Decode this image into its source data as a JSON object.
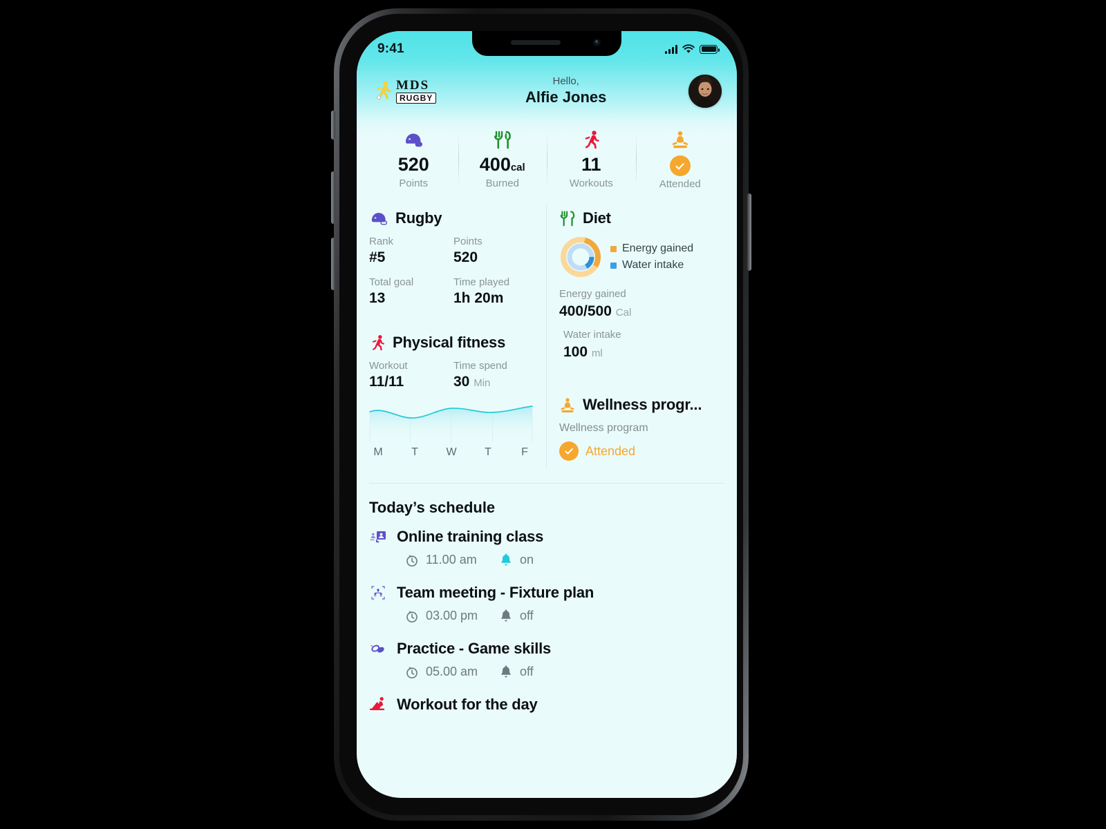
{
  "status_bar": {
    "time": "9:41",
    "signal_icon": "signal-bars-icon",
    "wifi_icon": "wifi-icon",
    "battery_icon": "battery-icon"
  },
  "header": {
    "logo_primary": "MDS",
    "logo_secondary": "RUGBY",
    "greeting": "Hello,",
    "user_name": "Alfie Jones",
    "avatar_icon": "user-avatar"
  },
  "stats": [
    {
      "icon": "rugby-helmet-icon",
      "value": "520",
      "unit": "",
      "label": "Points"
    },
    {
      "icon": "cutlery-icon",
      "value": "400",
      "unit": "cal",
      "label": "Burned"
    },
    {
      "icon": "running-icon",
      "value": "11",
      "unit": "",
      "label": "Workouts"
    },
    {
      "icon": "meditation-icon",
      "value": "",
      "unit": "",
      "label": "Attended",
      "badge": "check-circle-icon"
    }
  ],
  "rugby": {
    "icon": "rugby-helmet-icon",
    "title": "Rugby",
    "rank_label": "Rank",
    "rank_value": "#5",
    "points_label": "Points",
    "points_value": "520",
    "goal_label": "Total goal",
    "goal_value": "13",
    "time_label": "Time played",
    "time_value": "1h 20m"
  },
  "diet": {
    "icon": "cutlery-icon",
    "title": "Diet",
    "legend": [
      {
        "label": "Energy gained",
        "color": "#EFA93C"
      },
      {
        "label": "Water intake",
        "color": "#3D9FE0"
      }
    ],
    "energy_label": "Energy gained",
    "energy_value": "400/500",
    "energy_unit": "Cal",
    "water_label": "Water intake",
    "water_value": "100",
    "water_unit": "ml"
  },
  "fitness": {
    "icon": "running-icon",
    "title": "Physical fitness",
    "workout_label": "Workout",
    "workout_value": "11/11",
    "time_label": "Time spend",
    "time_value": "30",
    "time_unit": "Min"
  },
  "wellness": {
    "icon": "meditation-icon",
    "title": "Wellness progr...",
    "sub_label": "Wellness program",
    "status": "Attended",
    "status_icon": "check-circle-icon",
    "status_color": "#F6A72E"
  },
  "schedule": {
    "title": "Today’s schedule",
    "items": [
      {
        "icon": "online-class-icon",
        "name": "Online training class",
        "clock_icon": "stopwatch-icon",
        "time": "11.00 am",
        "bell_icon": "bell-icon",
        "alarm": "on",
        "alarm_on": true
      },
      {
        "icon": "team-meeting-icon",
        "name": "Team meeting - Fixture plan",
        "clock_icon": "stopwatch-icon",
        "time": "03.00 pm",
        "bell_icon": "bell-icon",
        "alarm": "off",
        "alarm_on": false
      },
      {
        "icon": "practice-icon",
        "name": "Practice - Game skills",
        "clock_icon": "stopwatch-icon",
        "time": "05.00 am",
        "bell_icon": "bell-icon",
        "alarm": "off",
        "alarm_on": false
      },
      {
        "icon": "workout-icon",
        "name": "Workout for the day",
        "clock_icon": "",
        "time": "",
        "bell_icon": "",
        "alarm": "",
        "alarm_on": false
      }
    ]
  },
  "chart_data": [
    {
      "type": "area",
      "title": "Physical fitness weekly activity",
      "categories": [
        "M",
        "T",
        "W",
        "T",
        "F"
      ],
      "values": [
        72,
        48,
        78,
        74,
        92
      ],
      "ylim": [
        0,
        100
      ],
      "xlabel": "",
      "ylabel": "",
      "grid": true,
      "legend": "none",
      "line_color": "#22C9D8",
      "fill_color": "#BFEFF5"
    },
    {
      "type": "pie",
      "title": "Diet progress",
      "labels": [
        "Energy gained",
        "Water intake"
      ],
      "series": [
        {
          "name": "Energy gained",
          "value": 400,
          "max": 500,
          "percent": 80,
          "color": "#EFA93C",
          "track_color": "#FBD79A"
        },
        {
          "name": "Water intake",
          "value": 100,
          "max": 500,
          "percent": 20,
          "color": "#3D9FE0",
          "track_color": "#BFDDF5"
        }
      ],
      "legend": "right"
    }
  ],
  "theme": {
    "screen_bg": "#EAFBFB",
    "header_gradient_start": "#4FE3E8",
    "header_gradient_end": "#EAFBFB",
    "accent_orange": "#F6A72E",
    "accent_cyan": "#22C9D8",
    "accent_purple": "#5B50C8",
    "text_dark": "#0B1012",
    "text_muted": "#8A9497"
  }
}
